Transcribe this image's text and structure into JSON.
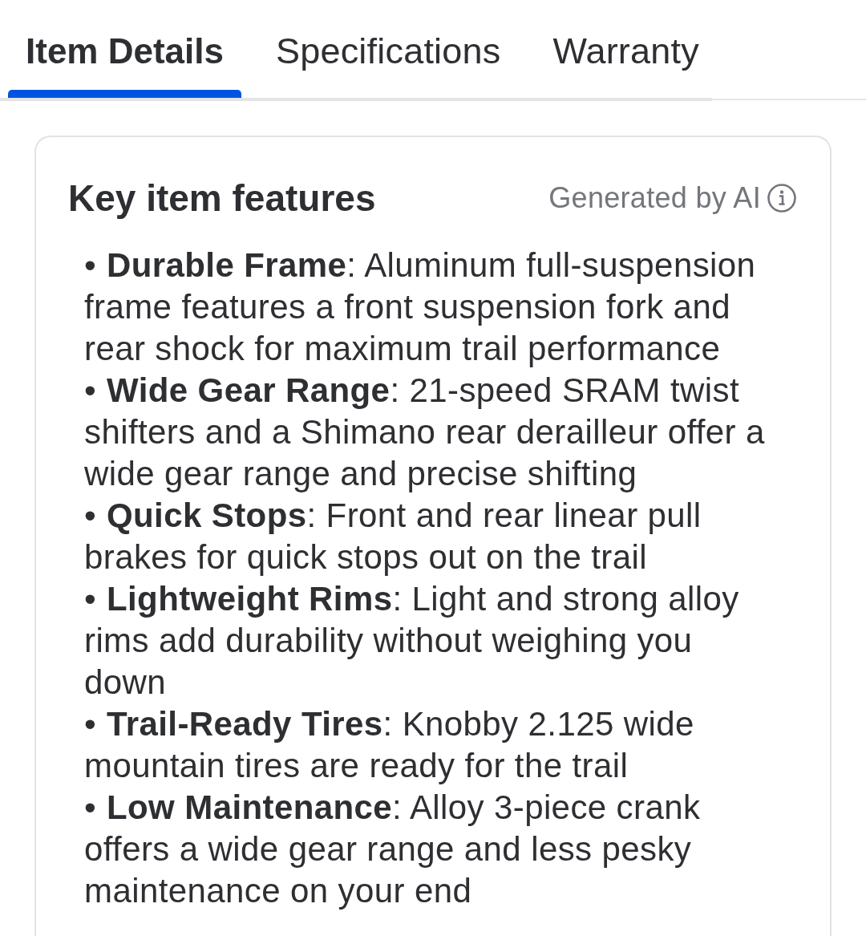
{
  "tabs": [
    {
      "label": "Item Details",
      "selected": true
    },
    {
      "label": "Specifications",
      "selected": false
    },
    {
      "label": "Warranty",
      "selected": false
    }
  ],
  "features_card": {
    "title": "Key item features",
    "badge": {
      "label": "Generated by AI"
    },
    "items": [
      {
        "bullet": "•",
        "text": "**Durable Frame**: Aluminum full-suspension frame features a front suspension fork and rear shock for maximum trail performance"
      },
      {
        "bullet": "•",
        "text": "**Wide Gear Range**: 21-speed SRAM twist shifters and a Shimano rear derailleur offer a wide gear range and precise shifting"
      },
      {
        "bullet": "•",
        "text": "**Quick Stops**: Front and rear linear pull brakes for quick stops out on the trail"
      },
      {
        "bullet": "•",
        "text": "**Lightweight Rims**: Light and strong alloy rims add durability without weighing you down"
      },
      {
        "bullet": "•",
        "text": "**Trail-Ready Tires**: Knobby 2.125 wide mountain tires are ready for the trail"
      },
      {
        "bullet": "•",
        "text": "**Low Maintenance**: Alloy 3-piece crank offers a wide gear range and less pesky maintenance on your end"
      }
    ]
  }
}
